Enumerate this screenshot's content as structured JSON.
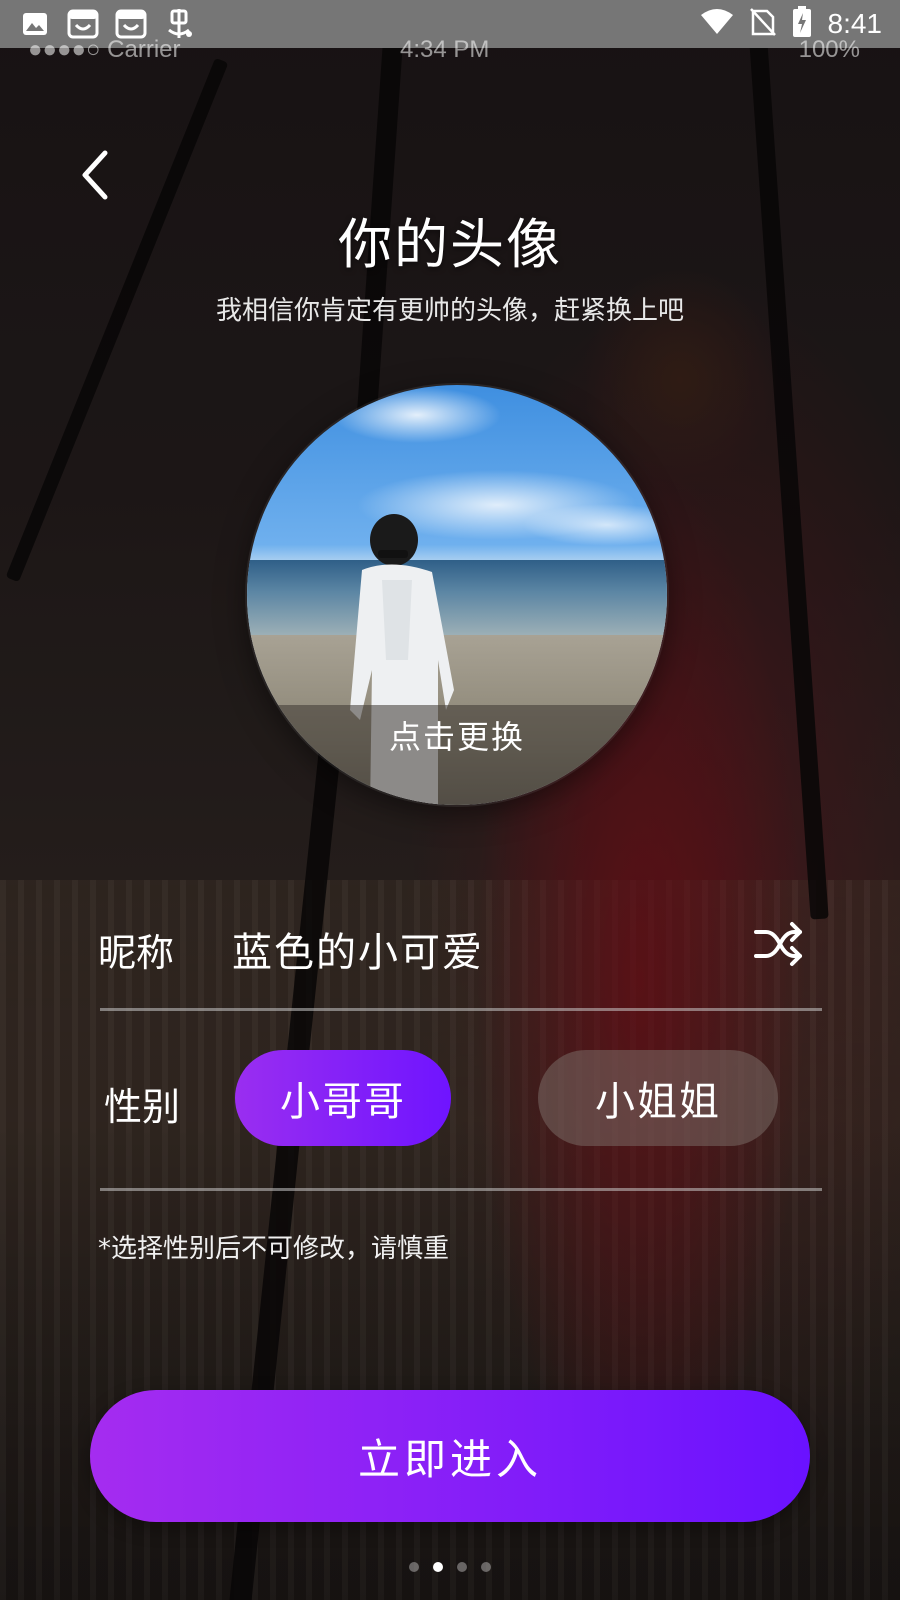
{
  "status_bar": {
    "time": "8:41",
    "icons": [
      "image-icon",
      "shop-icon",
      "shop-icon",
      "bug-icon",
      "wifi-icon",
      "no-sim-icon",
      "battery-charging-icon"
    ]
  },
  "ghost_status_bar": {
    "left": "●●●●○ Carrier",
    "center": "4:34 PM",
    "right": "100%"
  },
  "header": {
    "title": "你的头像",
    "subtitle": "我相信你肯定有更帅的头像，赶紧换上吧"
  },
  "avatar": {
    "change_label": "点击更换"
  },
  "nickname": {
    "label": "昵称",
    "value": "蓝色的小可爱",
    "shuffle_icon": "shuffle-icon"
  },
  "gender": {
    "label": "性别",
    "options": [
      {
        "label": "小哥哥",
        "selected": true
      },
      {
        "label": "小姐姐",
        "selected": false
      }
    ],
    "note": "*选择性别后不可修改，请慎重"
  },
  "enter_button": {
    "label": "立即进入"
  },
  "pager": {
    "count": 4,
    "active_index": 1
  },
  "colors": {
    "accent_start": "#9a2ef0",
    "accent_end": "#6a12ff",
    "unselected": "#786964"
  }
}
